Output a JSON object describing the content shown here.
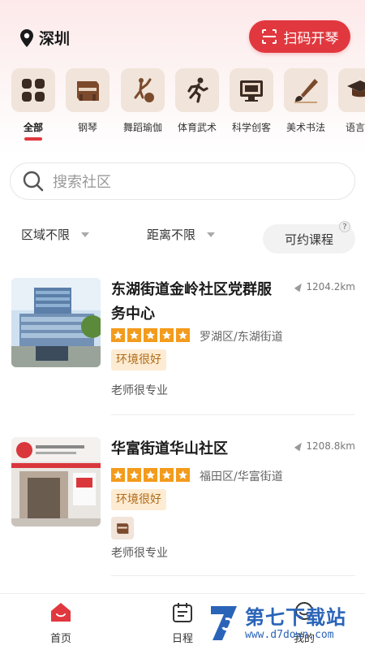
{
  "header": {
    "city": "深圳",
    "scan_label": "扫码开琴"
  },
  "categories": [
    {
      "label": "全部",
      "icon": "grid-icon",
      "active": true
    },
    {
      "label": "钢琴",
      "icon": "piano-icon"
    },
    {
      "label": "舞蹈瑜伽",
      "icon": "dance-icon"
    },
    {
      "label": "体育武术",
      "icon": "running-icon"
    },
    {
      "label": "科学创客",
      "icon": "monitor-icon"
    },
    {
      "label": "美术书法",
      "icon": "brush-icon"
    },
    {
      "label": "语言口",
      "icon": "graduation-cap-icon"
    }
  ],
  "search": {
    "placeholder": "搜索社区"
  },
  "filters": {
    "region": "区域不限",
    "distance": "距离不限",
    "available": "可约课程",
    "help": "?"
  },
  "listings": [
    {
      "title": "东湖街道金岭社区党群服务中心",
      "distance": "1204.2km",
      "rating": 5,
      "region": "罗湖区/东湖街道",
      "tag": "环境很好",
      "review": "老师很专业"
    },
    {
      "title": "华富街道华山社区",
      "distance": "1208.8km",
      "rating": 5,
      "region": "福田区/华富街道",
      "tag": "环境很好",
      "review": "老师很专业"
    }
  ],
  "bottom_nav": [
    {
      "label": "首页",
      "icon": "home-icon",
      "active": true
    },
    {
      "label": "日程",
      "icon": "calendar-icon"
    },
    {
      "label": "我的",
      "icon": "profile-icon"
    }
  ],
  "watermark": {
    "title": "第七下载站",
    "url": "www.d7down.com"
  },
  "colors": {
    "accent": "#e0383e",
    "star": "#f39b1c",
    "tag_bg": "#fdecd3"
  }
}
